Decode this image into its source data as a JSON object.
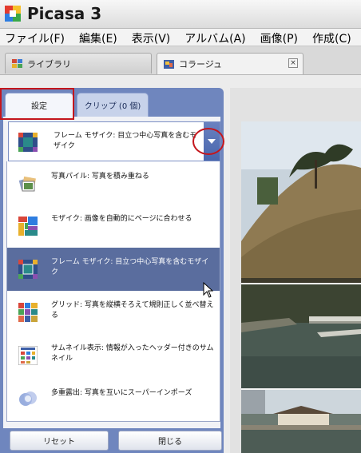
{
  "window": {
    "title": "Picasa 3",
    "logo_icon": "picasa-logo-icon"
  },
  "menu": [
    {
      "label": "ファイル(F)"
    },
    {
      "label": "編集(E)"
    },
    {
      "label": "表示(V)"
    },
    {
      "label": "アルバム(A)"
    },
    {
      "label": "画像(P)"
    },
    {
      "label": "作成(C)"
    }
  ],
  "tabs": {
    "library": {
      "label": "ライブラリ",
      "icon": "grid-icon"
    },
    "collage": {
      "label": "コラージュ",
      "icon": "collage-icon",
      "close_icon": "close-icon"
    }
  },
  "panel": {
    "tab_settings": "設定",
    "tab_clips": "クリップ (0 個)"
  },
  "dropdown": {
    "selected_label": "フレーム モザイク: 目立つ中心写真を含むモザイク",
    "arrow_icon": "chevron-down-icon"
  },
  "options": [
    {
      "label": "写真パイル: 写真を積み重ねる",
      "icon": "photo-pile-icon",
      "selected": false
    },
    {
      "label": "モザイク: 画像を自動的にページに合わせる",
      "icon": "mosaic-icon",
      "selected": false
    },
    {
      "label": "フレーム モザイク: 目立つ中心写真を含むモザイク",
      "icon": "frame-mosaic-icon",
      "selected": true
    },
    {
      "label": "グリッド: 写真を縦横そろえて規則正しく並べ替える",
      "icon": "grid-layout-icon",
      "selected": false
    },
    {
      "label": "サムネイル表示: 情報が入ったヘッダー付きのサムネイル",
      "icon": "thumbnail-sheet-icon",
      "selected": false
    },
    {
      "label": "多重露出: 写真を互いにスーパーインポーズ",
      "icon": "multi-exposure-icon",
      "selected": false
    }
  ],
  "buttons": {
    "reset": "リセット",
    "close": "閉じる"
  },
  "colors": {
    "panel_blue": "#6f86be",
    "selected_row": "#5a6d9e",
    "annotation_red": "#c4161c"
  }
}
